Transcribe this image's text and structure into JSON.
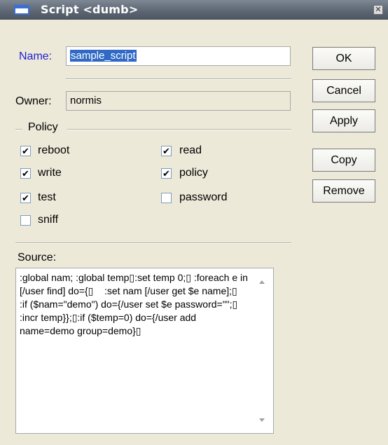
{
  "window": {
    "title": "Script <dumb>",
    "close_glyph": "✕"
  },
  "form": {
    "name_label": "Name:",
    "name_value": "sample_script",
    "owner_label": "Owner:",
    "owner_value": "normis",
    "policy_label": "Policy",
    "source_label": "Source:",
    "source_text": ":global nam; :global temp▯:set temp 0;▯ :foreach e in [/user find] do={▯    :set nam [/user get $e name];▯    :if ($nam=\"demo\") do={/user set $e password=\"\";▯        :incr temp}};▯:if ($temp=0) do={/user add name=demo group=demo}▯"
  },
  "policies": [
    {
      "label": "reboot",
      "checked": true
    },
    {
      "label": "read",
      "checked": true
    },
    {
      "label": "write",
      "checked": true
    },
    {
      "label": "policy",
      "checked": true
    },
    {
      "label": "test",
      "checked": true
    },
    {
      "label": "password",
      "checked": false
    },
    {
      "label": "sniff",
      "checked": false
    }
  ],
  "buttons": {
    "ok": "OK",
    "cancel": "Cancel",
    "apply": "Apply",
    "copy": "Copy",
    "remove": "Remove"
  },
  "colors": {
    "name_label": "#2020d8",
    "selection": "#316ac5"
  },
  "icons": {
    "window": "window-icon",
    "close": "close-icon",
    "check": "checkmark-icon"
  }
}
